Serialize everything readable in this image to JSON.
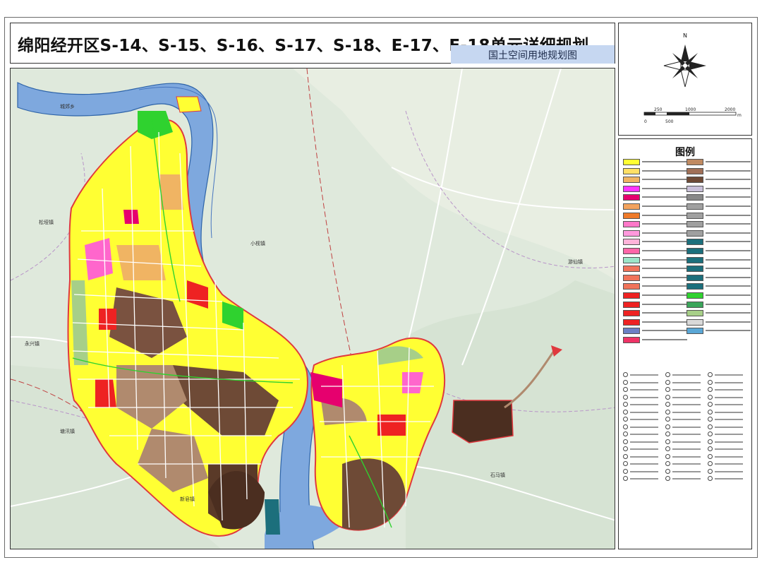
{
  "title": "绵阳经开区S-14、S-15、S-16、S-17、S-18、E-17、E-18单元详细规划",
  "subtitle": "国土空间用地规划图",
  "compass": {
    "north": "N",
    "scale_labels": [
      "0",
      "250",
      "500",
      "1000",
      "2000"
    ],
    "scale_unit": "m"
  },
  "legend": {
    "title": "图例",
    "colors": {
      "residential": "#ffff33",
      "commercial": "#e8564a",
      "industrial": "#6e4a36",
      "logistics": "#b08a6e",
      "green": "#2fd22f",
      "park": "#a7cf88",
      "water": "#7ea8de",
      "public": "#ff66cc",
      "school": "#ff9a33",
      "utility": "#1c6f7c",
      "boundary": "#e0393e"
    },
    "left_swatches": [
      "#ffff33",
      "#ffe066",
      "#f0b463",
      "#ff33ff",
      "#e6006e",
      "#f2a35e",
      "#ef7a2a",
      "#ff77c8",
      "#ff99dd",
      "#ffb3d9",
      "#ff66a8",
      "#9be6c8",
      "#f0735a",
      "#f0735a",
      "#f0735a",
      "#ee2222",
      "#ee2222",
      "#ee2222",
      "#ee2222",
      "#6b7fc5",
      "#ee3366"
    ],
    "right_swatches": [
      "#c08a62",
      "#a07058",
      "#6e4a36",
      "#c9c0d9",
      "#888888",
      "#a0a0a0",
      "#a0a0a0",
      "#a0a0a0",
      "#a0a0a0",
      "#1c6f7c",
      "#1c6f7c",
      "#1c6f7c",
      "#1c6f7c",
      "#1c6f7c",
      "#1c6f7c",
      "#2fd22f",
      "#3aa55a",
      "#a7cf88",
      "#d9d9d9",
      "#5aa7d6"
    ]
  },
  "places": [
    "小枧镇",
    "城郊乡",
    "松垭镇",
    "永兴镇",
    "塘汛镇",
    "新皂镇",
    "游仙镇",
    "石马镇"
  ]
}
